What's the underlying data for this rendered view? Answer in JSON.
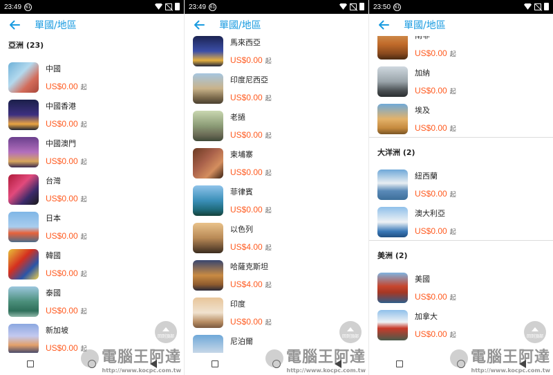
{
  "app": {
    "title": "單國/地區"
  },
  "price_suffix": "起",
  "fab_label": "回到頂部",
  "watermark": {
    "text": "電腦王阿達",
    "url": "http://www.kocpc.com.tw"
  },
  "screens": [
    {
      "time": "23:49",
      "notif": "61",
      "sections": [
        {
          "header": "亞洲 (23)",
          "items": [
            {
              "name": "中國",
              "price": "US$0.00",
              "icon": "china-photo",
              "bg": "linear-gradient(135deg,#6fb1d8,#b3d9ee 40%,#d36c5a 70%,#a8473a)"
            },
            {
              "name": "中國香港",
              "price": "US$0.00",
              "icon": "hongkong-photo",
              "bg": "linear-gradient(180deg,#1b1f4a,#3d3080 50%,#e9a443 80%,#1f2533)"
            },
            {
              "name": "中國澳門",
              "price": "US$0.00",
              "icon": "macau-photo",
              "bg": "linear-gradient(180deg,#6a3f8d,#b36fbd 50%,#d7a55b 80%,#3c2a52)"
            },
            {
              "name": "台灣",
              "price": "US$0.00",
              "icon": "taiwan-photo",
              "bg": "linear-gradient(135deg,#b01a3a,#e24a7c 40%,#3b2a6a 70%,#1a1a1a)"
            },
            {
              "name": "日本",
              "price": "US$0.00",
              "icon": "japan-photo",
              "bg": "linear-gradient(180deg,#7fb6e6,#a9cdee 50%,#e7623b 70%,#4d6c88)"
            },
            {
              "name": "韓國",
              "price": "US$0.00",
              "icon": "korea-photo",
              "bg": "linear-gradient(135deg,#e8c13a,#d5301f 40%,#2a55a8 70%,#f0d04a)"
            },
            {
              "name": "泰國",
              "price": "US$0.00",
              "icon": "thailand-photo",
              "bg": "linear-gradient(180deg,#9cc7de,#4a8e7a 50%,#2f6f5a 80%,#8fb8a9)"
            },
            {
              "name": "新加坡",
              "price": "US$0.00",
              "icon": "singapore-photo",
              "bg": "linear-gradient(180deg,#8ba7e0,#c3c9ef 40%,#e3a06a 70%,#2d3b6a)"
            }
          ]
        }
      ]
    },
    {
      "time": "23:49",
      "notif": "61",
      "sections": [
        {
          "header": "",
          "items": [
            {
              "name": "馬來西亞",
              "price": "US$0.00",
              "icon": "malaysia-photo",
              "bg": "linear-gradient(180deg,#1c2452,#3b4ea8 50%,#e4b040 80%,#20243a)"
            },
            {
              "name": "印度尼西亞",
              "price": "US$0.00",
              "icon": "indonesia-photo",
              "bg": "linear-gradient(180deg,#a6c6e0,#c9b38a 50%,#7b6a4c 80%,#4a4030)"
            },
            {
              "name": "老撾",
              "price": "US$0.00",
              "icon": "laos-photo",
              "bg": "linear-gradient(180deg,#c9d7b0,#8b9b76 50%,#6a6a55 80%,#3f4a38)"
            },
            {
              "name": "柬埔寨",
              "price": "US$0.00",
              "icon": "cambodia-photo",
              "bg": "linear-gradient(135deg,#6b3a22,#a8604a 40%,#d48e5e 70%,#3a2214)"
            },
            {
              "name": "菲律賓",
              "price": "US$0.00",
              "icon": "philippines-photo",
              "bg": "linear-gradient(180deg,#8fc3ea,#3a8fb8 50%,#1f6a7a 80%,#15423a)"
            },
            {
              "name": "以色列",
              "price": "US$4.00",
              "icon": "israel-photo",
              "bg": "linear-gradient(180deg,#e9c28a,#b98a56 50%,#6f5236 80%,#3a2c1e)"
            },
            {
              "name": "哈薩克斯坦",
              "price": "US$4.00",
              "icon": "kazakhstan-photo",
              "bg": "linear-gradient(180deg,#39466f,#c98b43 50%,#8f5b2e 80%,#2a2a38)"
            },
            {
              "name": "印度",
              "price": "US$0.00",
              "icon": "india-photo",
              "bg": "linear-gradient(180deg,#e8c59a,#f0e2cf 50%,#b88d63 80%,#7a5a40)"
            },
            {
              "name": "尼泊爾",
              "price": "",
              "icon": "nepal-photo",
              "bg": "linear-gradient(180deg,#6fa8d8,#c8d8e8 60%,#7a9a6a)"
            }
          ]
        }
      ]
    },
    {
      "time": "23:50",
      "notif": "61",
      "sections": [
        {
          "header": "",
          "items": [
            {
              "name": "南非",
              "price": "US$0.00",
              "icon": "southafrica-photo",
              "bg": "linear-gradient(180deg,#d8a060,#c06a2a 50%,#8a4a1e 80%,#4a2a12)"
            },
            {
              "name": "加納",
              "price": "US$0.00",
              "icon": "ghana-photo",
              "bg": "linear-gradient(180deg,#cfd8df,#9aa4aa 50%,#4a4f52 80%,#2a2e30)"
            },
            {
              "name": "埃及",
              "price": "US$0.00",
              "icon": "egypt-photo",
              "bg": "linear-gradient(180deg,#6fa9d8,#e3b26a 50%,#c58a3e 80%,#7a5524)"
            }
          ]
        },
        {
          "header": "大洋洲 (2)",
          "items": [
            {
              "name": "紐西蘭",
              "price": "US$0.00",
              "icon": "newzealand-photo",
              "bg": "linear-gradient(180deg,#6ea8d8,#e8eef2 45%,#5a8ab8 70%,#3d6f9a)"
            },
            {
              "name": "澳大利亞",
              "price": "US$0.00",
              "icon": "australia-photo",
              "bg": "linear-gradient(180deg,#8fc0ea,#eef2f5 50%,#3a79b8 80%,#1f4f82)"
            }
          ]
        },
        {
          "header": "美洲 (2)",
          "items": [
            {
              "name": "美國",
              "price": "US$0.00",
              "icon": "usa-photo",
              "bg": "linear-gradient(180deg,#7fb3e0,#c6462e 45%,#a63724 65%,#2f5e8a)"
            },
            {
              "name": "加拿大",
              "price": "US$0.00",
              "icon": "canada-photo",
              "bg": "linear-gradient(180deg,#8fc0ea,#eef2f5 40%,#c83a2a 60%,#4a5a4a)"
            }
          ]
        }
      ]
    }
  ]
}
